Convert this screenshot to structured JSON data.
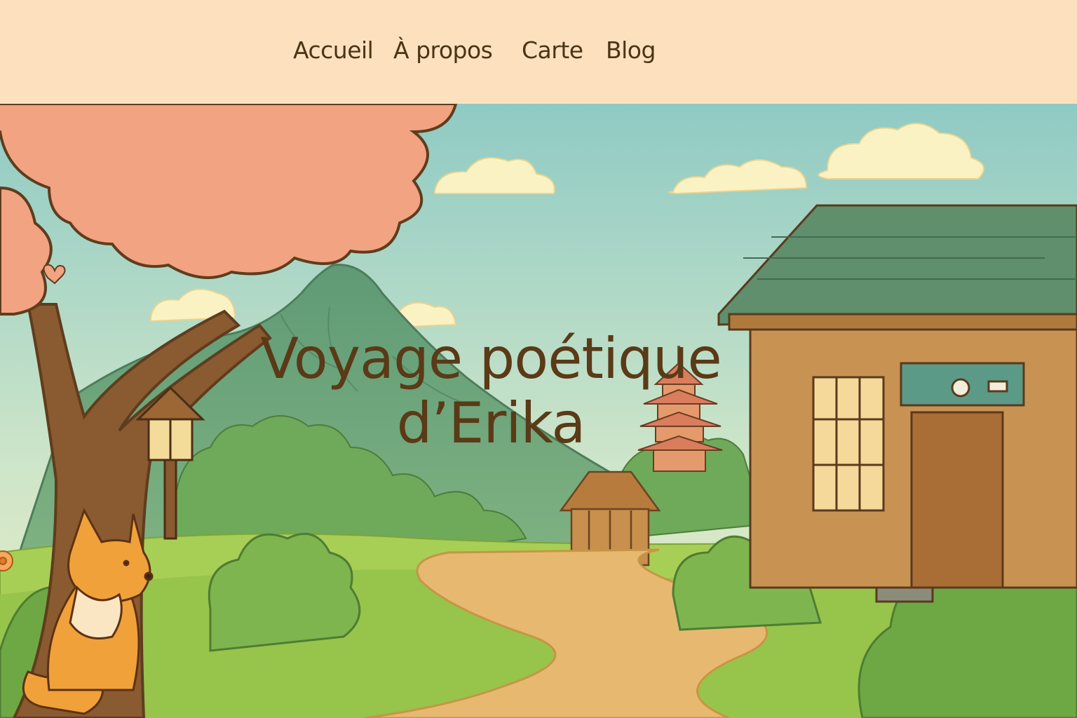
{
  "nav": {
    "items": [
      {
        "label": "Accueil"
      },
      {
        "label": "À propos"
      },
      {
        "label": "Carte"
      },
      {
        "label": "Blog"
      }
    ]
  },
  "hero": {
    "title_line1": "Voyage poétique",
    "title_line2": "d’Erika"
  },
  "colors": {
    "header_bg": "#fde1bf",
    "text": "#5a3a17",
    "sky": "#bfe0cc",
    "blossom": "#f2a381",
    "grass": "#9ec74f"
  }
}
